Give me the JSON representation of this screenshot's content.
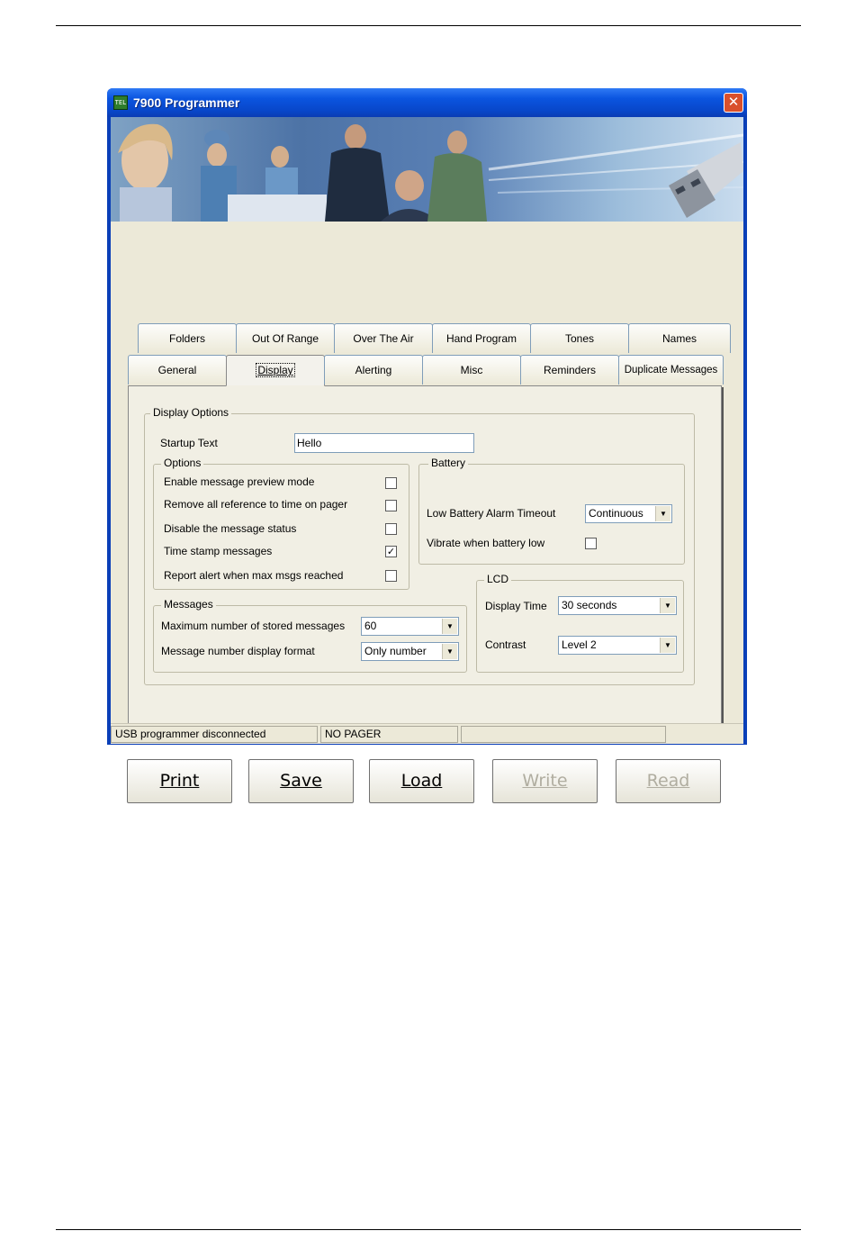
{
  "window": {
    "title": "7900 Programmer",
    "icon_text": "TEL",
    "close_symbol": "✕"
  },
  "tabs_row1": [
    {
      "label": "Folders"
    },
    {
      "label": "Out Of Range"
    },
    {
      "label": "Over The Air"
    },
    {
      "label": "Hand Program"
    },
    {
      "label": "Tones"
    },
    {
      "label": "Names"
    }
  ],
  "tabs_row2": [
    {
      "label": "General"
    },
    {
      "label": "Display"
    },
    {
      "label": "Alerting"
    },
    {
      "label": "Misc"
    },
    {
      "label": "Reminders"
    },
    {
      "label": "Duplicate Messages"
    }
  ],
  "active_tab": "Display",
  "display_options": {
    "group_label": "Display Options",
    "startup_text_label": "Startup Text",
    "startup_text_value": "Hello",
    "options": {
      "group_label": "Options",
      "items": [
        {
          "label": "Enable message preview mode",
          "checked": false
        },
        {
          "label": "Remove all reference to time on pager",
          "checked": false
        },
        {
          "label": "Disable the message status",
          "checked": false
        },
        {
          "label": "Time stamp messages",
          "checked": true
        },
        {
          "label": "Report alert when max msgs reached",
          "checked": false
        }
      ]
    },
    "battery": {
      "group_label": "Battery",
      "alarm_timeout_label": "Low Battery Alarm Timeout",
      "alarm_timeout_value": "Continuous",
      "vibrate_label": "Vibrate when battery low",
      "vibrate_checked": false
    },
    "messages": {
      "group_label": "Messages",
      "max_stored_label": "Maximum number of stored messages",
      "max_stored_value": "60",
      "number_format_label": "Message number display format",
      "number_format_value": "Only number"
    },
    "lcd": {
      "group_label": "LCD",
      "display_time_label": "Display Time",
      "display_time_value": "30 seconds",
      "contrast_label": "Contrast",
      "contrast_value": "Level 2"
    }
  },
  "buttons": {
    "print": {
      "label": "Print",
      "enabled": true
    },
    "save": {
      "label": "Save",
      "enabled": true
    },
    "load": {
      "label": "Load",
      "enabled": true
    },
    "write": {
      "label": "Write",
      "enabled": false
    },
    "read": {
      "label": "Read",
      "enabled": false
    }
  },
  "status_bar": {
    "connection": "USB programmer disconnected",
    "pager": "NO PAGER",
    "extra": ""
  },
  "colors": {
    "title_bar": "#0b55e0",
    "window_body": "#ece9d8",
    "close_button": "#d9502c"
  }
}
